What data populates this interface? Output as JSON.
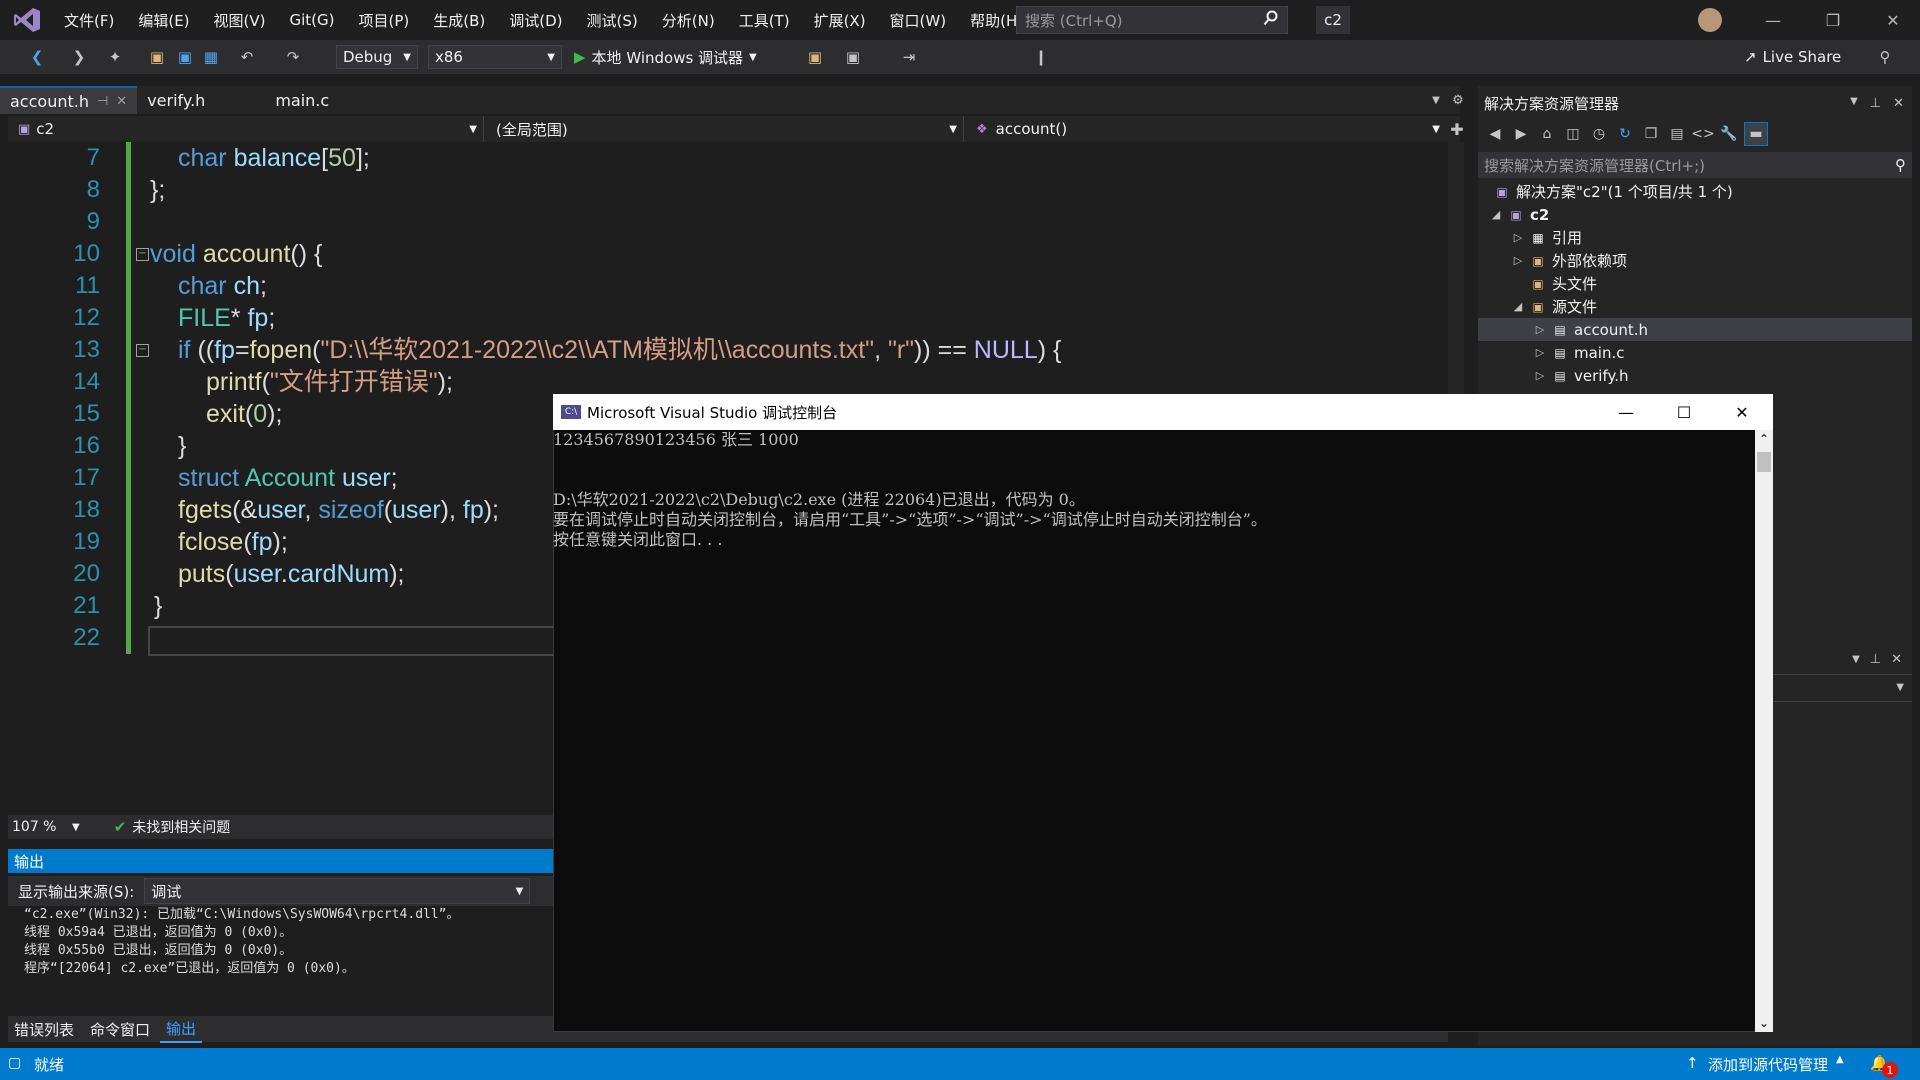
{
  "app": {
    "menu": [
      "文件(F)",
      "编辑(E)",
      "视图(V)",
      "Git(G)",
      "项目(P)",
      "生成(B)",
      "调试(D)",
      "测试(S)",
      "分析(N)",
      "工具(T)",
      "扩展(X)",
      "窗口(W)",
      "帮助(H)"
    ],
    "search_placeholder": "搜索 (Ctrl+Q)",
    "solution_badge": "c2"
  },
  "toolbar": {
    "config": "Debug",
    "platform": "x86",
    "run_label": "本地 Windows 调试器",
    "live_share": "Live Share"
  },
  "tabs": [
    {
      "label": "account.h",
      "active": true
    },
    {
      "label": "verify.h",
      "active": false
    },
    {
      "label": "main.c",
      "active": false
    }
  ],
  "navbar": {
    "project": "c2",
    "scope": "(全局范围)",
    "member": "account()"
  },
  "editor": {
    "line_numbers": [
      "7",
      "8",
      "9",
      "10",
      "11",
      "12",
      "13",
      "14",
      "15",
      "16",
      "17",
      "18",
      "19",
      "20",
      "21",
      "22"
    ],
    "fopen_path": "\"D:\\\\华软2021-2022\\\\c2\\\\ATM模拟机\\\\accounts.txt\"",
    "error_msg": "\"文件打开错误\"",
    "zoom": "107 %",
    "issues": "未找到相关问题"
  },
  "output": {
    "title": "输出",
    "source_label": "显示输出来源(S):",
    "source_value": "调试",
    "lines": [
      "“c2.exe”(Win32): 已加载“C:\\Windows\\SysWOW64\\rpcrt4.dll”。",
      "线程 0x59a4 已退出，返回值为 0 (0x0)。",
      "线程 0x55b0 已退出，返回值为 0 (0x0)。",
      "程序“[22064] c2.exe”已退出，返回值为 0 (0x0)。"
    ],
    "bottom_tabs": [
      "错误列表",
      "命令窗口",
      "输出"
    ]
  },
  "solution_explorer": {
    "title": "解决方案资源管理器",
    "search_placeholder": "搜索解决方案资源管理器(Ctrl+;)",
    "solution": "解决方案\"c2\"(1 个项目/共 1 个)",
    "project": "c2",
    "nodes": [
      "引用",
      "外部依赖项",
      "头文件",
      "源文件"
    ],
    "files": [
      "account.h",
      "main.c",
      "verify.h"
    ]
  },
  "console": {
    "title": "Microsoft Visual Studio 调试控制台",
    "lines": [
      "1234567890123456 张三 1000",
      "",
      "D:\\华软2021-2022\\c2\\Debug\\c2.exe (进程 22064)已退出，代码为 0。",
      "要在调试停止时自动关闭控制台，请启用“工具”->“选项”->“调试”->“调试停止时自动关闭控制台”。",
      "按任意键关闭此窗口. . ."
    ]
  },
  "status": {
    "ready": "就绪",
    "source_control": "添加到源代码管理",
    "notifications": "1"
  },
  "colors": {
    "accent": "#007acc",
    "background": "#1e1e1e",
    "keyword": "#569cd6",
    "type": "#4ec9b0",
    "string": "#d69d85",
    "change_bar": "#57a64a"
  }
}
